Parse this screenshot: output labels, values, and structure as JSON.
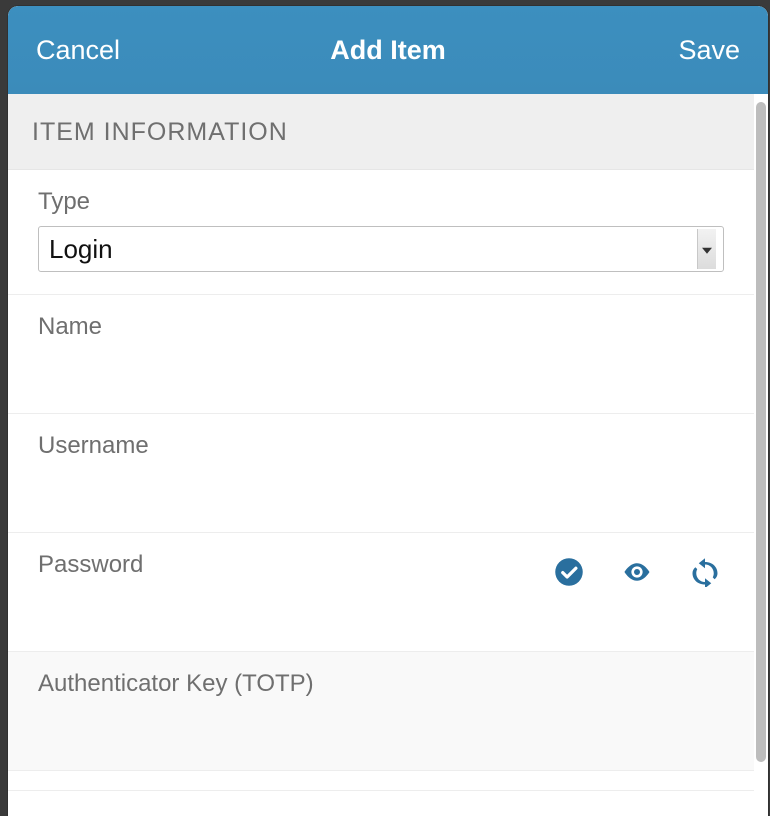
{
  "header": {
    "cancel": "Cancel",
    "title": "Add Item",
    "save": "Save"
  },
  "section": {
    "title": "ITEM INFORMATION"
  },
  "fields": {
    "type": {
      "label": "Type",
      "value": "Login"
    },
    "name": {
      "label": "Name",
      "value": ""
    },
    "username": {
      "label": "Username",
      "value": ""
    },
    "password": {
      "label": "Password",
      "value": ""
    },
    "totp": {
      "label": "Authenticator Key (TOTP)",
      "value": ""
    }
  }
}
